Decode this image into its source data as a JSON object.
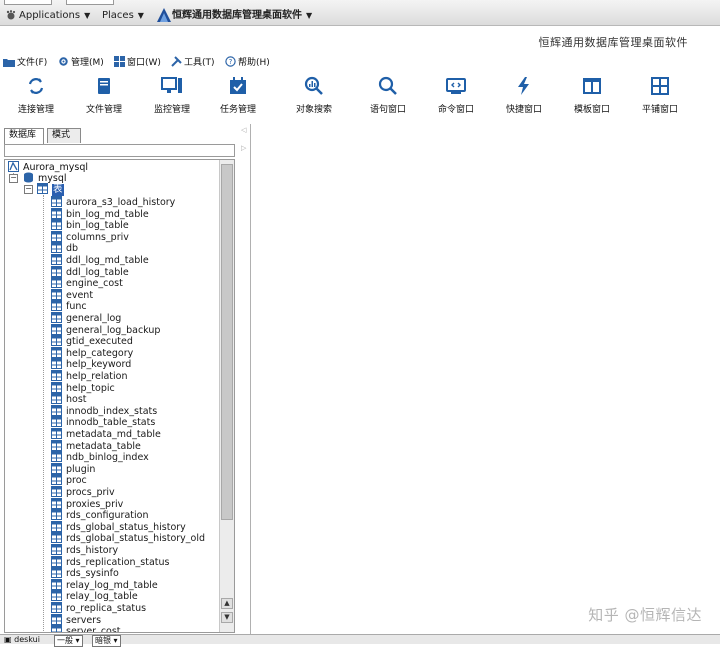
{
  "panel": {
    "applications": "Applications",
    "places": "Places",
    "app_title": "恒辉通用数据库管理桌面软件"
  },
  "window_title": "恒辉通用数据库管理桌面软件",
  "menu": [
    {
      "label": "文件(F)",
      "icon": "folder-icon"
    },
    {
      "label": "管理(M)",
      "icon": "gear-icon"
    },
    {
      "label": "窗口(W)",
      "icon": "windows-icon"
    },
    {
      "label": "工具(T)",
      "icon": "tools-icon"
    },
    {
      "label": "帮助(H)",
      "icon": "help-icon"
    }
  ],
  "toolbar": [
    {
      "label": "连接管理",
      "icon": "refresh-icon"
    },
    {
      "label": "文件管理",
      "icon": "book-icon"
    },
    {
      "label": "监控管理",
      "icon": "monitor-icon"
    },
    {
      "label": "任务管理",
      "icon": "calendar-check-icon"
    },
    {
      "label": "对象搜索",
      "icon": "chart-search-icon"
    },
    {
      "label": "语句窗口",
      "icon": "search-icon"
    },
    {
      "label": "命令窗口",
      "icon": "terminal-icon"
    },
    {
      "label": "快捷窗口",
      "icon": "lightning-icon"
    },
    {
      "label": "模板窗口",
      "icon": "columns-icon"
    },
    {
      "label": "平铺窗口",
      "icon": "grid-icon"
    }
  ],
  "left_tabs": {
    "db": "数据库",
    "mode": "模式"
  },
  "tree": {
    "connection": "Aurora_mysql",
    "schema": "mysql",
    "table_group": "表",
    "tables": [
      "aurora_s3_load_history",
      "bin_log_md_table",
      "bin_log_table",
      "columns_priv",
      "db",
      "ddl_log_md_table",
      "ddl_log_table",
      "engine_cost",
      "event",
      "func",
      "general_log",
      "general_log_backup",
      "gtid_executed",
      "help_category",
      "help_keyword",
      "help_relation",
      "help_topic",
      "host",
      "innodb_index_stats",
      "innodb_table_stats",
      "metadata_md_table",
      "metadata_table",
      "ndb_binlog_index",
      "plugin",
      "proc",
      "procs_priv",
      "proxies_priv",
      "rds_configuration",
      "rds_global_status_history",
      "rds_global_status_history_old",
      "rds_history",
      "rds_replication_status",
      "rds_sysinfo",
      "relay_log_md_table",
      "relay_log_table",
      "ro_replica_status",
      "servers",
      "server_cost"
    ]
  },
  "status": {
    "desk": "deskui",
    "mode": "一般",
    "theme": "暗银"
  },
  "watermark": "知乎 @恒辉信达",
  "colors": {
    "accent": "#1f5fa8",
    "selected": "#2a5fb0",
    "table_icon": "#2c64a8"
  }
}
